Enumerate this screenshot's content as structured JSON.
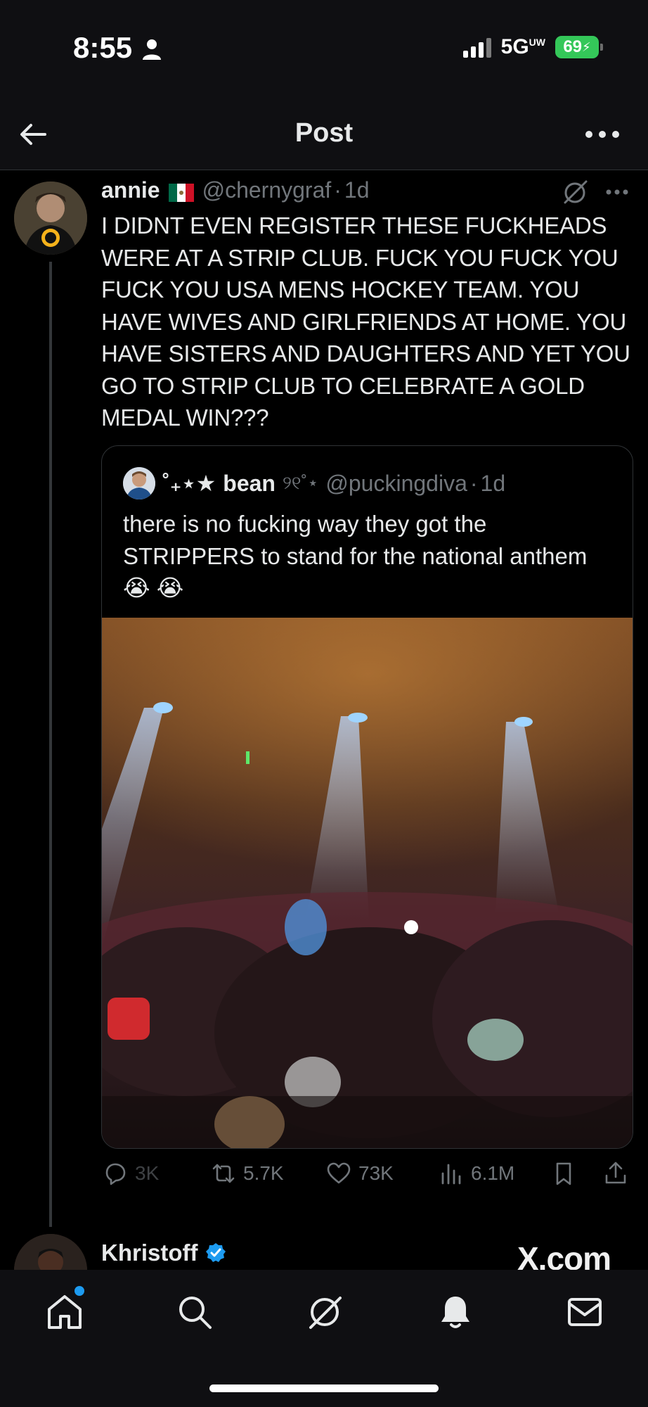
{
  "status_bar": {
    "time": "8:55",
    "network": "5G",
    "network_suffix": "UW",
    "battery": "69"
  },
  "header": {
    "title": "Post"
  },
  "tweet": {
    "name": "annie",
    "flag": "mexico-flag-icon",
    "handle": "@chernygraf",
    "separator": "·",
    "age": "1d",
    "text": "I DIDNT EVEN REGISTER THESE FUCKHEADS WERE AT A STRIP CLUB. FUCK YOU FUCK YOU FUCK YOU USA MENS HOCKEY TEAM. YOU HAVE WIVES AND GIRLFRIENDS AT HOME. YOU HAVE SISTERS AND DAUGHTERS AND YET YOU GO TO STRIP CLUB TO CELEBRATE A GOLD MEDAL WIN???"
  },
  "quote": {
    "name_prefix": "˚₊⋆★",
    "name": "bean",
    "name_suffix": "୨୧˚⋆",
    "handle": "@puckingdiva",
    "separator": "·",
    "age": "1d",
    "text": "there is no fucking way they got the STRIPPERS to stand for the national anthem 😭 😭"
  },
  "actions": {
    "replies": "3K",
    "reposts": "5.7K",
    "likes": "73K",
    "views": "6.1M"
  },
  "next_reply": {
    "name": "Khristoff",
    "verified": true
  },
  "watermark": "X.com",
  "colors": {
    "background": "#000000",
    "text": "#e7e9ea",
    "muted": "#71767b",
    "accent": "#1d9bf0",
    "battery": "#34c759"
  },
  "tab_bar": [
    "home-icon",
    "search-icon",
    "grok-icon",
    "notifications-icon",
    "messages-icon"
  ]
}
